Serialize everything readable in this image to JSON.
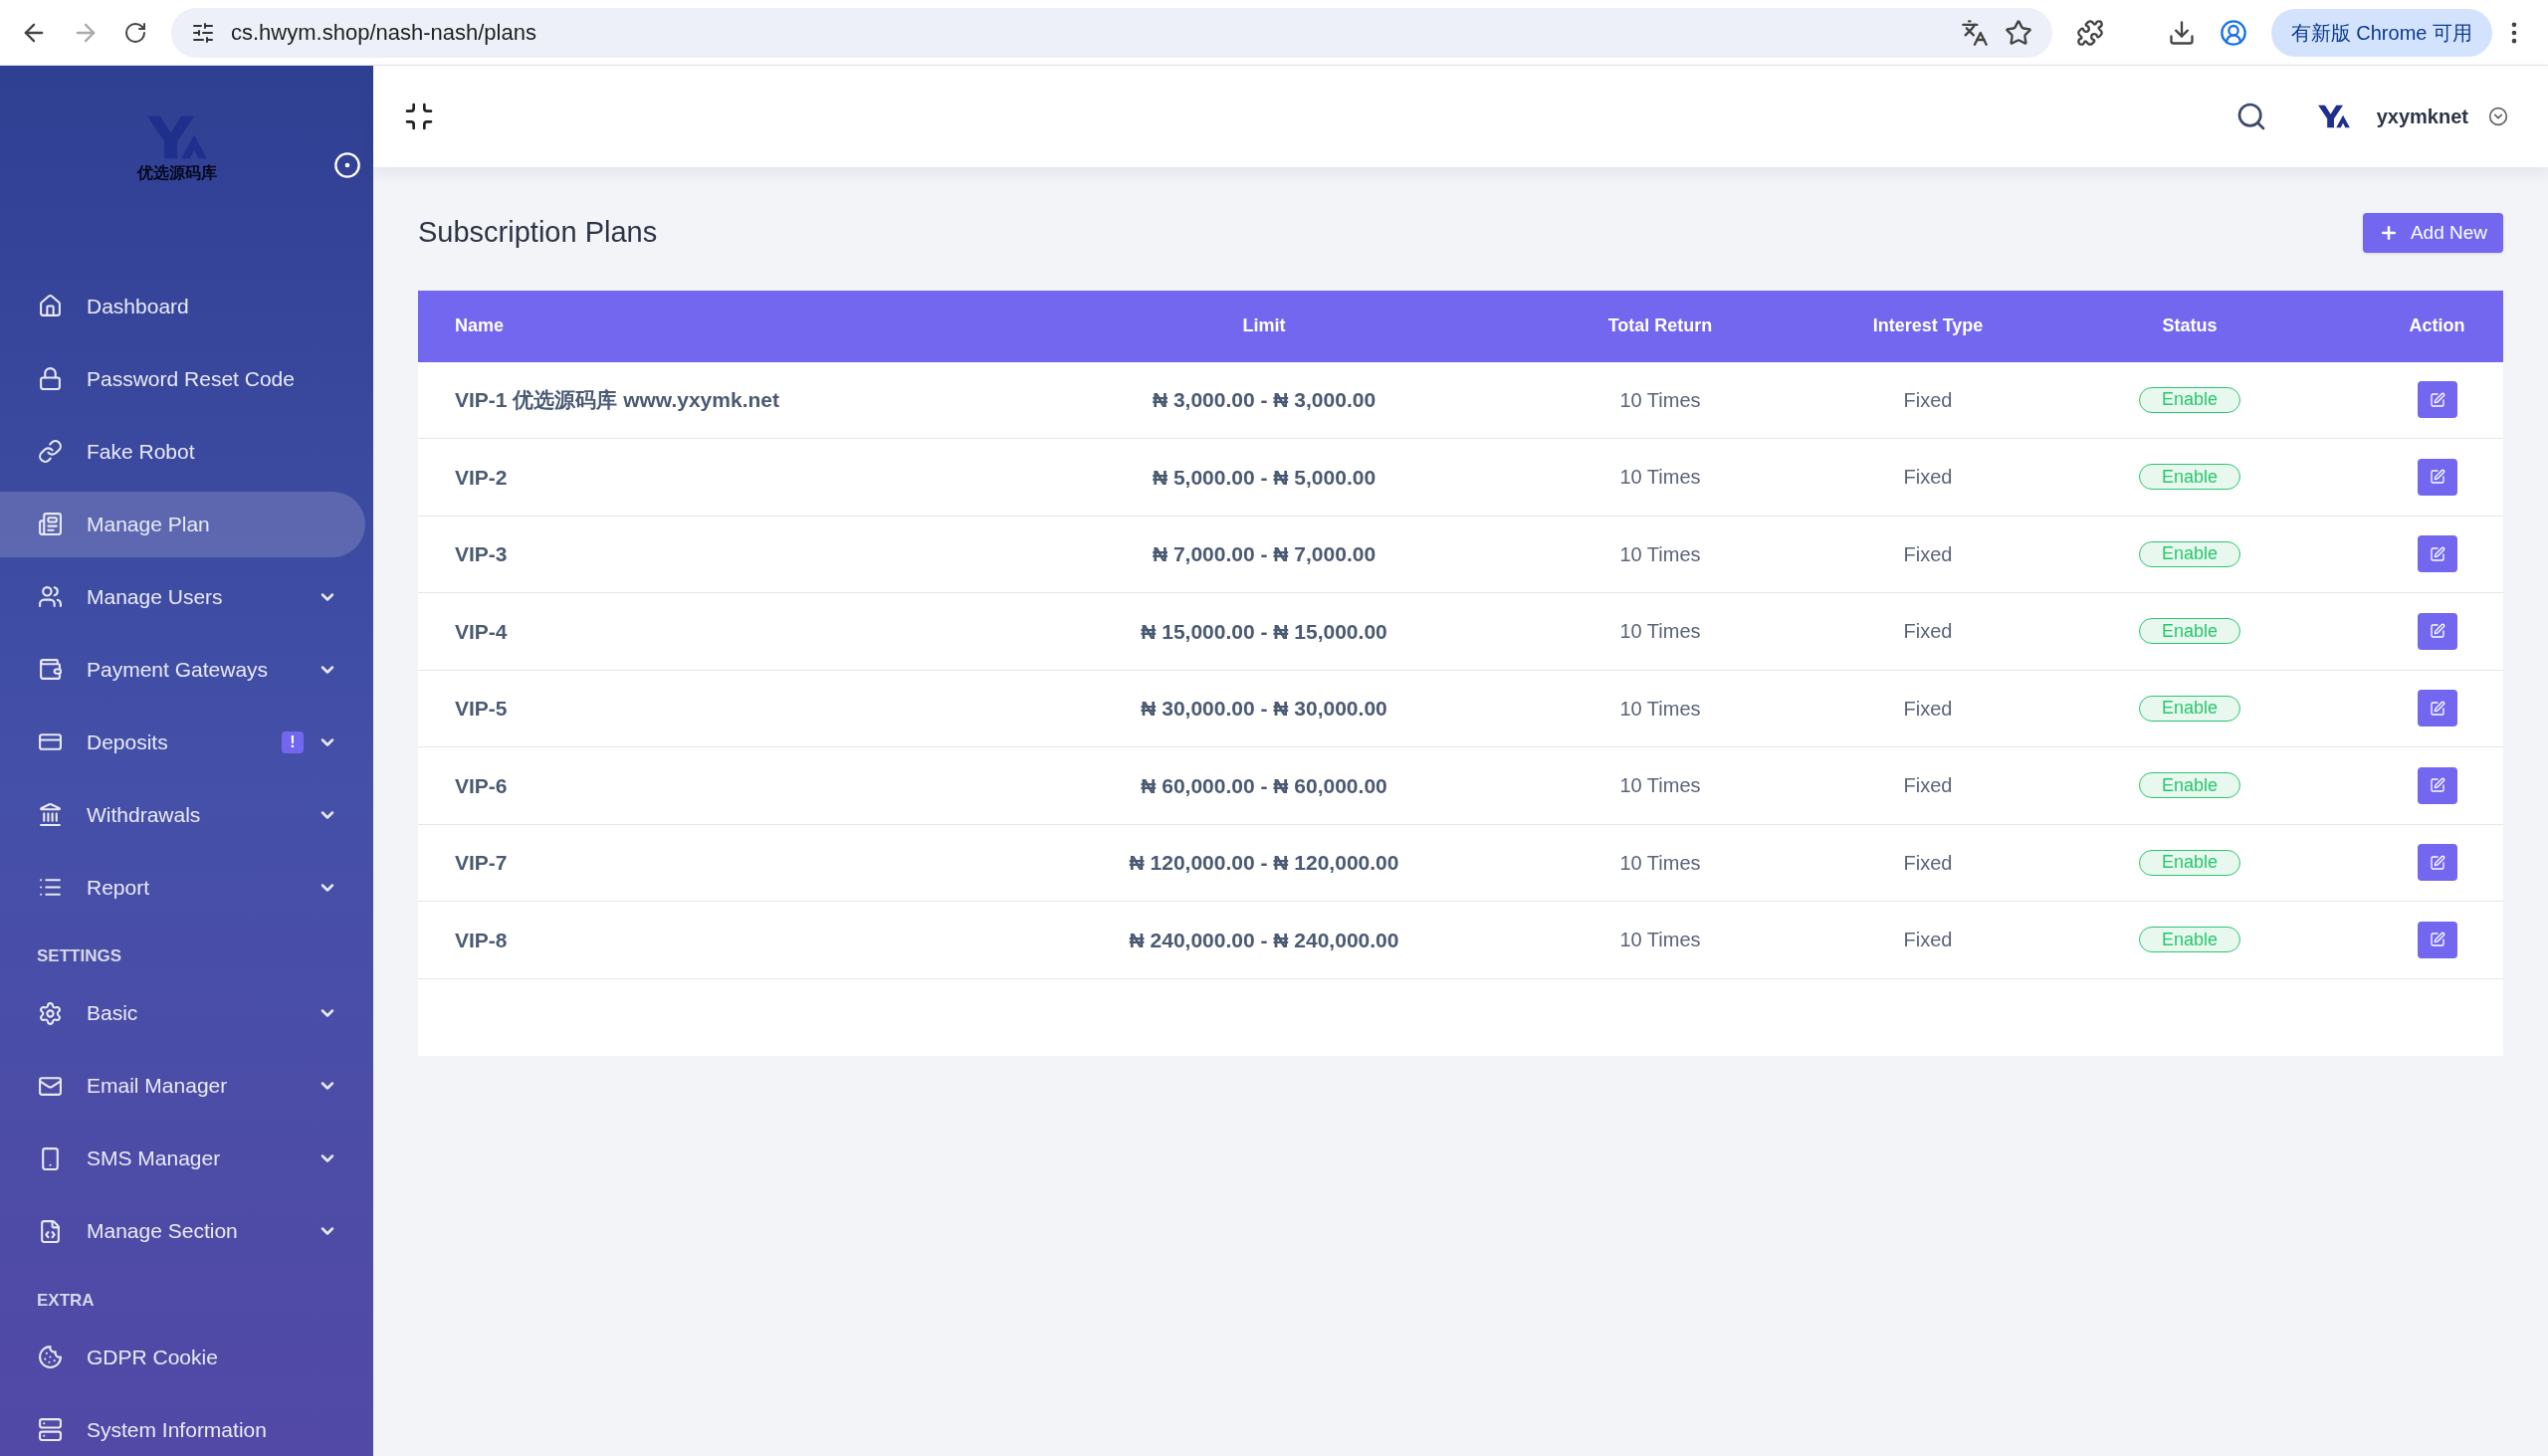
{
  "browser": {
    "url": "cs.hwym.shop/nash-nash/plans",
    "update_button": "有新版 Chrome 可用"
  },
  "sidebar": {
    "logo_text": "优选源码库",
    "sections": [
      {
        "items": [
          {
            "label": "Dashboard",
            "selected": false,
            "expandable": false
          },
          {
            "label": "Password Reset Code",
            "selected": false,
            "expandable": false
          },
          {
            "label": "Fake Robot",
            "selected": false,
            "expandable": false
          },
          {
            "label": "Manage Plan",
            "selected": true,
            "expandable": false
          },
          {
            "label": "Manage Users",
            "selected": false,
            "expandable": true
          },
          {
            "label": "Payment Gateways",
            "selected": false,
            "expandable": true
          },
          {
            "label": "Deposits",
            "selected": false,
            "expandable": true,
            "badge": "!"
          },
          {
            "label": "Withdrawals",
            "selected": false,
            "expandable": true
          },
          {
            "label": "Report",
            "selected": false,
            "expandable": true
          }
        ]
      },
      {
        "heading": "SETTINGS",
        "items": [
          {
            "label": "Basic",
            "selected": false,
            "expandable": true
          },
          {
            "label": "Email Manager",
            "selected": false,
            "expandable": true
          },
          {
            "label": "SMS Manager",
            "selected": false,
            "expandable": true
          },
          {
            "label": "Manage Section",
            "selected": false,
            "expandable": true
          }
        ]
      },
      {
        "heading": "EXTRA",
        "items": [
          {
            "label": "GDPR Cookie",
            "selected": false,
            "expandable": false
          },
          {
            "label": "System Information",
            "selected": false,
            "expandable": false
          }
        ]
      }
    ]
  },
  "header": {
    "username": "yxymknet"
  },
  "page": {
    "title": "Subscription Plans",
    "add_button": "Add New"
  },
  "table": {
    "columns": [
      "Name",
      "Limit",
      "Total Return",
      "Interest Type",
      "Status",
      "Action"
    ],
    "rows": [
      {
        "name": "VIP-1 优选源码库 www.yxymk.net",
        "limit": "₦ 3,000.00 - ₦ 3,000.00",
        "total_return": "10 Times",
        "interest_type": "Fixed",
        "status": "Enable",
        "enabled": true
      },
      {
        "name": "VIP-2",
        "limit": "₦ 5,000.00 - ₦ 5,000.00",
        "total_return": "10 Times",
        "interest_type": "Fixed",
        "status": "Enable",
        "enabled": true
      },
      {
        "name": "VIP-3",
        "limit": "₦ 7,000.00 - ₦ 7,000.00",
        "total_return": "10 Times",
        "interest_type": "Fixed",
        "status": "Enable",
        "enabled": true
      },
      {
        "name": "VIP-4",
        "limit": "₦ 15,000.00 - ₦ 15,000.00",
        "total_return": "10 Times",
        "interest_type": "Fixed",
        "status": "Enable",
        "enabled": true
      },
      {
        "name": "VIP-5",
        "limit": "₦ 30,000.00 - ₦ 30,000.00",
        "total_return": "10 Times",
        "interest_type": "Fixed",
        "status": "Enable",
        "enabled": true
      },
      {
        "name": "VIP-6",
        "limit": "₦ 60,000.00 - ₦ 60,000.00",
        "total_return": "10 Times",
        "interest_type": "Fixed",
        "status": "Enable",
        "enabled": true
      },
      {
        "name": "VIP-7",
        "limit": "₦ 120,000.00 - ₦ 120,000.00",
        "total_return": "10 Times",
        "interest_type": "Fixed",
        "status": "Enable",
        "enabled": true
      },
      {
        "name": "VIP-8",
        "limit": "₦ 240,000.00 - ₦ 240,000.00",
        "total_return": "10 Times",
        "interest_type": "Fixed",
        "status": "Enable",
        "enabled": true
      }
    ]
  }
}
